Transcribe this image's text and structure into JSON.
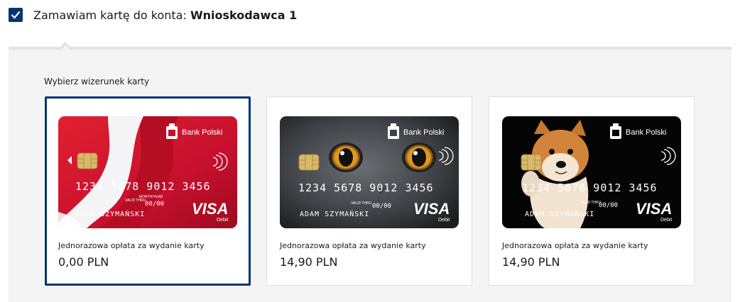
{
  "header": {
    "checkbox_checked": true,
    "label_prefix": "Zamawiam kartę do konta:",
    "label_account": "Wnioskodawca 1"
  },
  "section": {
    "title": "Wybierz wizerunek karty"
  },
  "cards": [
    {
      "design": "red",
      "selected": true,
      "fee_label": "Jednorazowa opłata za wydanie karty",
      "fee_value": "0,00 PLN",
      "bank": "Bank Polski",
      "number": "1234  5678  9012  3456",
      "holder": "ADAM SZYMAŃSKI",
      "valid_label": "VALID THRU",
      "month_year_label": "MONTH/YEAR",
      "valid": "00/00",
      "network": "VISA",
      "type": "Debit"
    },
    {
      "design": "cat",
      "selected": false,
      "fee_label": "Jednorazowa opłata za wydanie karty",
      "fee_value": "14,90 PLN",
      "bank": "Bank Polski",
      "number": "1234  5678  9012  3456",
      "holder": "ADAM SZYMAŃSKI",
      "valid_label": "VALID THRU",
      "valid": "00/00",
      "network": "VISA",
      "type": "Debit"
    },
    {
      "design": "dog",
      "selected": false,
      "fee_label": "Jednorazowa opłata za wydanie karty",
      "fee_value": "14,90 PLN",
      "bank": "Bank Polski",
      "number": "1234  5678  9012  3456",
      "holder": "ADAM SZYMAŃSKI",
      "valid_label": "VALID THRU",
      "valid": "00/00",
      "network": "VISA",
      "type": "Debit"
    }
  ],
  "colors": {
    "accent": "#003574",
    "panel_bg": "#f4f4f4",
    "card_red": "#c8102e"
  }
}
